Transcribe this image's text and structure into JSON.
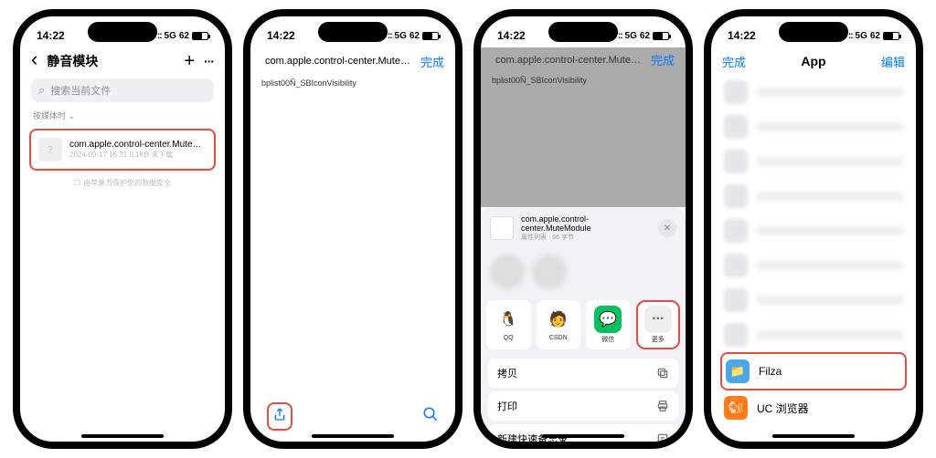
{
  "status": {
    "time": "14:22",
    "network": "5G",
    "battery_text": "62"
  },
  "phone1": {
    "nav": {
      "title": "静音模块",
      "back_icon": "chevron-left",
      "plus_icon": "plus",
      "more_icon": "more"
    },
    "search_placeholder": "搜索当前文件",
    "sort_label": "按媒体时 ⌄",
    "file": {
      "name": "com.apple.control-center.MuteModule.plist",
      "meta": "2024-09-17  16:31  0.1KB   未下载"
    },
    "footer": "由苹果方保护您的数据安全"
  },
  "phone2": {
    "title": "com.apple.control-center.MuteModu...",
    "done": "完成",
    "content": "bplist00Ñ_SBIconVisibility"
  },
  "phone3": {
    "title": "com.apple.control-center.MuteModu...",
    "done": "完成",
    "content": "bplist00Ñ_SBIconVisibility",
    "share": {
      "file_name": "com.apple.control-center.MuteModule",
      "file_meta": "属性列表 · 66 字节",
      "apps": [
        {
          "label": "QQ",
          "color": "#fff"
        },
        {
          "label": "CSDN",
          "color": "#fff"
        },
        {
          "label": "微信",
          "color": "#07c160"
        },
        {
          "label": "更多",
          "color": "#eee"
        }
      ],
      "actions": [
        {
          "label": "拷贝",
          "icon": "copy"
        },
        {
          "label": "打印",
          "icon": "print"
        },
        {
          "label": "新建快速备忘录",
          "icon": "note"
        }
      ]
    }
  },
  "phone4": {
    "done": "完成",
    "title": "App",
    "edit": "编辑",
    "apps": [
      {
        "name": "Filza",
        "icon_bg": "#4aa7e8"
      },
      {
        "name": "UC 浏览器",
        "icon_bg": "#ff7b1a"
      }
    ]
  }
}
